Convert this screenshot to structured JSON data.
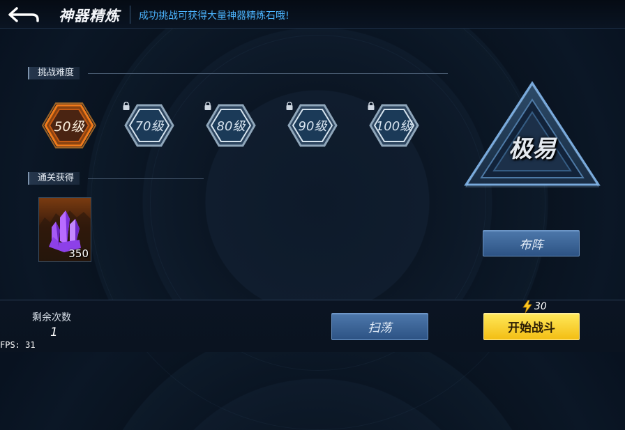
{
  "header": {
    "title": "神器精炼",
    "tip": "成功挑战可获得大量神器精炼石哦!"
  },
  "difficulty_section": {
    "label": "挑战难度",
    "levels": [
      {
        "label": "50级",
        "locked": false,
        "selected": true
      },
      {
        "label": "70级",
        "locked": true,
        "selected": false
      },
      {
        "label": "80级",
        "locked": true,
        "selected": false
      },
      {
        "label": "90级",
        "locked": true,
        "selected": false
      },
      {
        "label": "100级",
        "locked": true,
        "selected": false
      }
    ]
  },
  "reward_section": {
    "label": "通关获得",
    "items": [
      {
        "icon": "purple-crystal-icon",
        "count": "350"
      }
    ]
  },
  "difficulty": {
    "text": "极易"
  },
  "buttons": {
    "formation": "布阵",
    "sweep": "扫荡",
    "start": "开始战斗"
  },
  "footer": {
    "remaining_label": "剩余次数",
    "remaining_value": "1",
    "energy_cost": "30",
    "energy_icon": "lightning-icon"
  },
  "fps": "FPS: 31",
  "colors": {
    "selected_level": "#f07a1a",
    "tip_text": "#4cb5ff",
    "start_button": "#f6c91e",
    "blue_button": "#3a6497",
    "crystal": "#9b45f0"
  }
}
